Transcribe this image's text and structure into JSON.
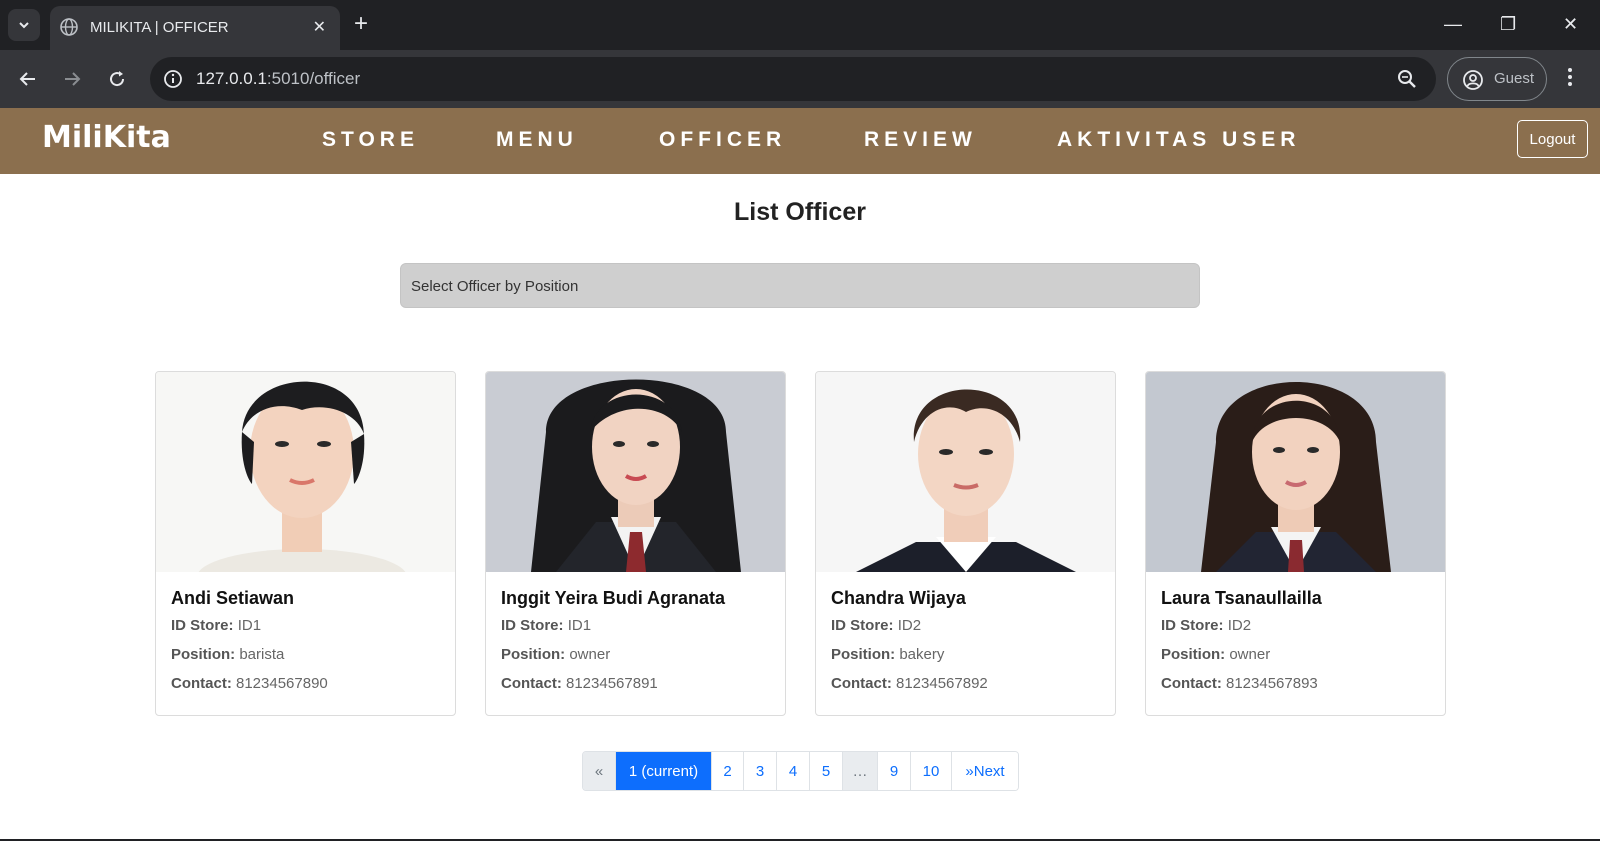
{
  "browser": {
    "tab_title": "MILIKITA | OFFICER",
    "url_host": "127.0.0.1",
    "url_path": ":5010/officer",
    "profile_label": "Guest"
  },
  "site": {
    "brand": "MiliKita",
    "nav": [
      "STORE",
      "MENU",
      "OFFICER",
      "REVIEW",
      "AKTIVITAS USER"
    ],
    "logout_label": "Logout"
  },
  "page": {
    "title": "List Officer",
    "filter_placeholder": "Select Officer by Position"
  },
  "labels": {
    "id_store": "ID Store:",
    "position": "Position:",
    "contact": "Contact:"
  },
  "officers": [
    {
      "name": "Andi Setiawan",
      "id_store": "ID1",
      "position": "barista",
      "contact": "81234567890"
    },
    {
      "name": "Inggit Yeira Budi Agranata",
      "id_store": "ID1",
      "position": "owner",
      "contact": "81234567891"
    },
    {
      "name": "Chandra Wijaya",
      "id_store": "ID2",
      "position": "bakery",
      "contact": "81234567892"
    },
    {
      "name": "Laura Tsanaullailla",
      "id_store": "ID2",
      "position": "owner",
      "contact": "81234567893"
    }
  ],
  "pagination": {
    "prev": "«",
    "pages": [
      "1 (current)",
      "2",
      "3",
      "4",
      "5",
      "…",
      "9",
      "10"
    ],
    "next": "»Next"
  },
  "colors": {
    "navbar": "#8b6f4e",
    "primary": "#0d6efd"
  }
}
